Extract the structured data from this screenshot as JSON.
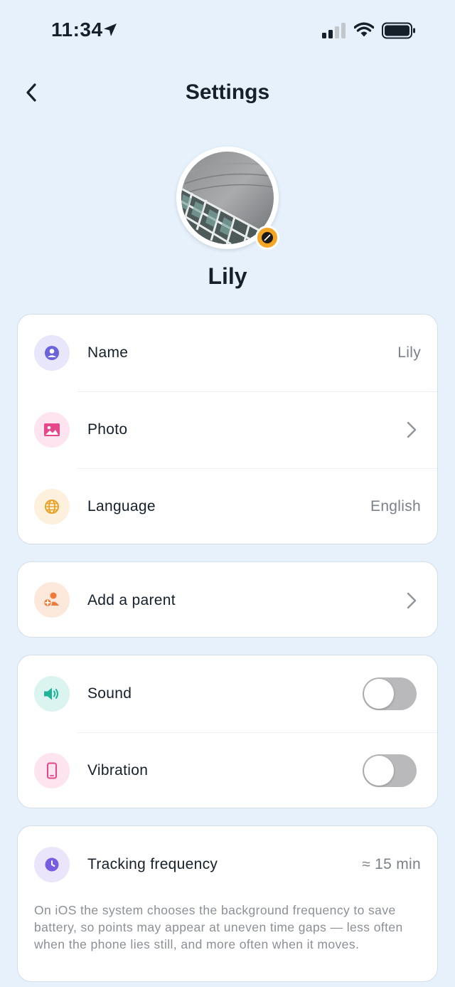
{
  "status_bar": {
    "time": "11:34",
    "icons": [
      "location-arrow-icon",
      "cellular-signal-icon",
      "wifi-icon",
      "battery-icon"
    ]
  },
  "header": {
    "title": "Settings",
    "back_icon": "chevron-left-icon"
  },
  "profile": {
    "name": "Lily",
    "edit_icon": "pencil-icon",
    "edit_badge_color": "#f5a524"
  },
  "profile_card": {
    "rows": [
      {
        "label": "Name",
        "value": "Lily",
        "icon": "user-icon",
        "icon_color": "#6b63d9",
        "icon_bg": "#e8e6fb"
      },
      {
        "label": "Photo",
        "icon": "image-icon",
        "icon_color": "#e6478b",
        "icon_bg": "#fde4ef"
      },
      {
        "label": "Language",
        "value": "English",
        "icon": "globe-icon",
        "icon_color": "#e9a126",
        "icon_bg": "#fdf0dc"
      }
    ]
  },
  "parent_card": {
    "rows": [
      {
        "label": "Add a parent",
        "icon": "add-user-icon",
        "icon_color": "#f07a35",
        "icon_bg": "#fde8dc"
      }
    ]
  },
  "feedback_card": {
    "rows": [
      {
        "label": "Sound",
        "icon": "speaker-icon",
        "icon_color": "#1fb39a",
        "icon_bg": "#dcf4ef",
        "enabled": false
      },
      {
        "label": "Vibration",
        "icon": "phone-icon",
        "icon_color": "#e6478b",
        "icon_bg": "#fde4ef",
        "enabled": false
      }
    ]
  },
  "tracking_card": {
    "label": "Tracking frequency",
    "value": "≈ 15 min",
    "icon": "clock-icon",
    "icon_color": "#7a5ce0",
    "icon_bg": "#ebe5fb",
    "note": "On iOS the system chooses the background frequency to save battery, so points may appear at uneven time gaps — less often when the phone lies still, and more often when it moves."
  },
  "colors": {
    "background": "#e6f1fc",
    "card": "#ffffff",
    "toggle_off": "#b9b9bc"
  }
}
